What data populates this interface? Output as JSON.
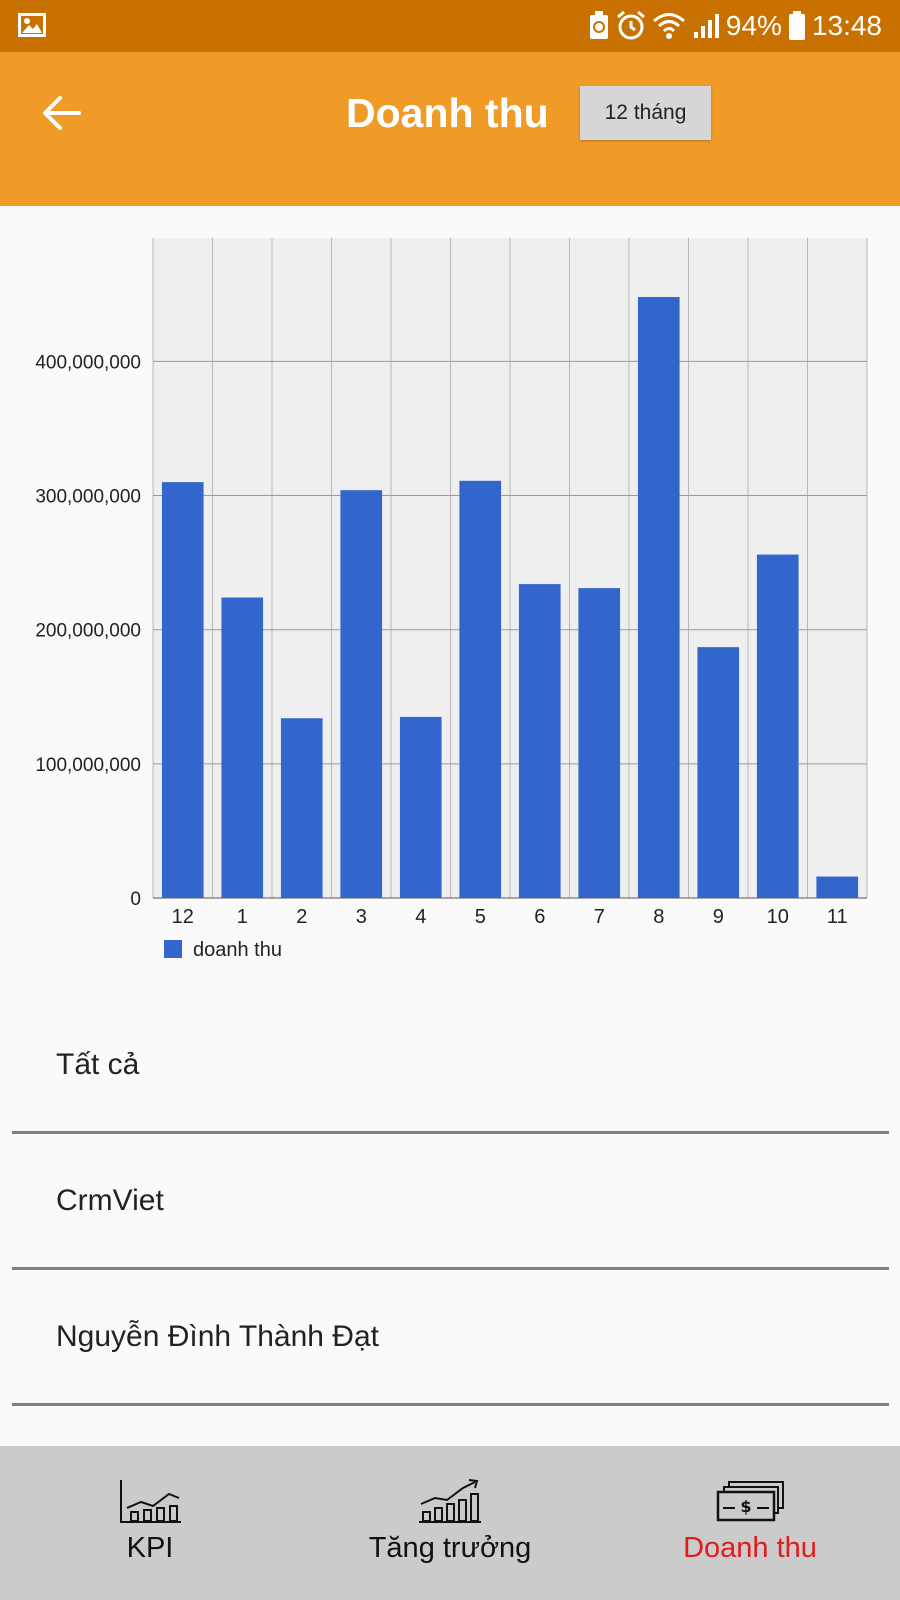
{
  "status_bar": {
    "battery": "94%",
    "time": "13:48"
  },
  "app_bar": {
    "title": "Doanh thu",
    "period_button": "12 tháng"
  },
  "chart_data": {
    "type": "bar",
    "categories": [
      "12",
      "1",
      "2",
      "3",
      "4",
      "5",
      "6",
      "7",
      "8",
      "9",
      "10",
      "11"
    ],
    "series": [
      {
        "name": "doanh thu",
        "color": "#3366cc",
        "values": [
          310000000,
          224000000,
          134000000,
          304000000,
          135000000,
          311000000,
          234000000,
          231000000,
          448000000,
          187000000,
          256000000,
          16000000
        ]
      }
    ],
    "yticks": [
      {
        "value": 0,
        "label": "0"
      },
      {
        "value": 100000000,
        "label": "100,000,000"
      },
      {
        "value": 200000000,
        "label": "200,000,000"
      },
      {
        "value": 300000000,
        "label": "300,000,000"
      },
      {
        "value": 400000000,
        "label": "400,000,000"
      }
    ],
    "ylim": [
      0,
      492000000
    ],
    "grid": true,
    "legend_position": "bottom-left",
    "plot_background": "#efeff0"
  },
  "list": {
    "items": [
      "Tất cả",
      "CrmViet",
      "Nguyễn Đình Thành Đạt"
    ]
  },
  "bottom_nav": {
    "items": [
      {
        "label": "KPI",
        "icon": "kpi-chart-icon"
      },
      {
        "label": "Tăng trưởng",
        "icon": "growth-chart-icon"
      },
      {
        "label": "Doanh thu",
        "icon": "money-icon"
      }
    ],
    "active_index": 2,
    "active_color": "#e21a1a"
  },
  "colors": {
    "status_bar": "#c97100",
    "app_bar": "#f09a27",
    "bar": "#3366cc",
    "nav_background": "#cbcbcb"
  }
}
